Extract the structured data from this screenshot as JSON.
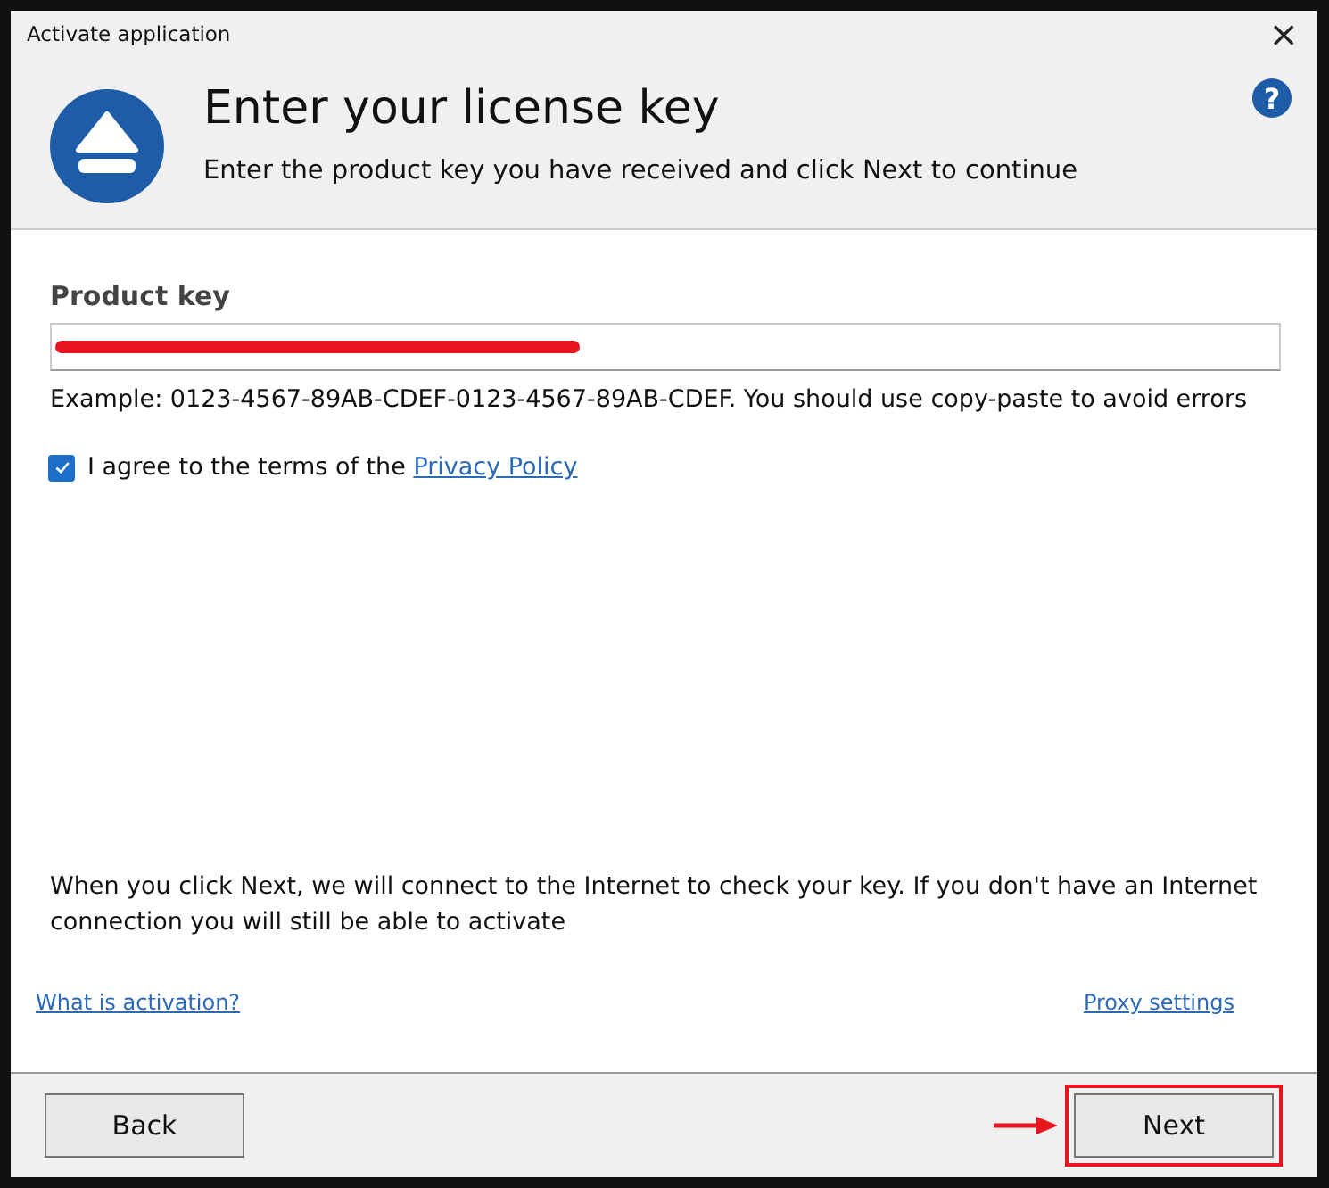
{
  "window": {
    "title": "Activate application",
    "close": "×"
  },
  "header": {
    "title": "Enter your license key",
    "subtitle": "Enter the product key you have received and click Next to continue",
    "help": "?"
  },
  "product_key": {
    "label": "Product key",
    "redacted": true,
    "example": "Example: 0123-4567-89AB-CDEF-0123-4567-89AB-CDEF. You should use copy-paste to avoid errors"
  },
  "agree": {
    "checked": true,
    "text": "I agree to the terms of the ",
    "link": "Privacy Policy"
  },
  "notice": "When you click Next, we will connect to the Internet to check your key. If you don't have an Internet connection you will still be able to activate",
  "links": [
    "What is activation?",
    "Proxy settings"
  ],
  "buttons": [
    {
      "label": "Back",
      "highlighted": false
    },
    {
      "label": "Next",
      "highlighted": true
    }
  ]
}
